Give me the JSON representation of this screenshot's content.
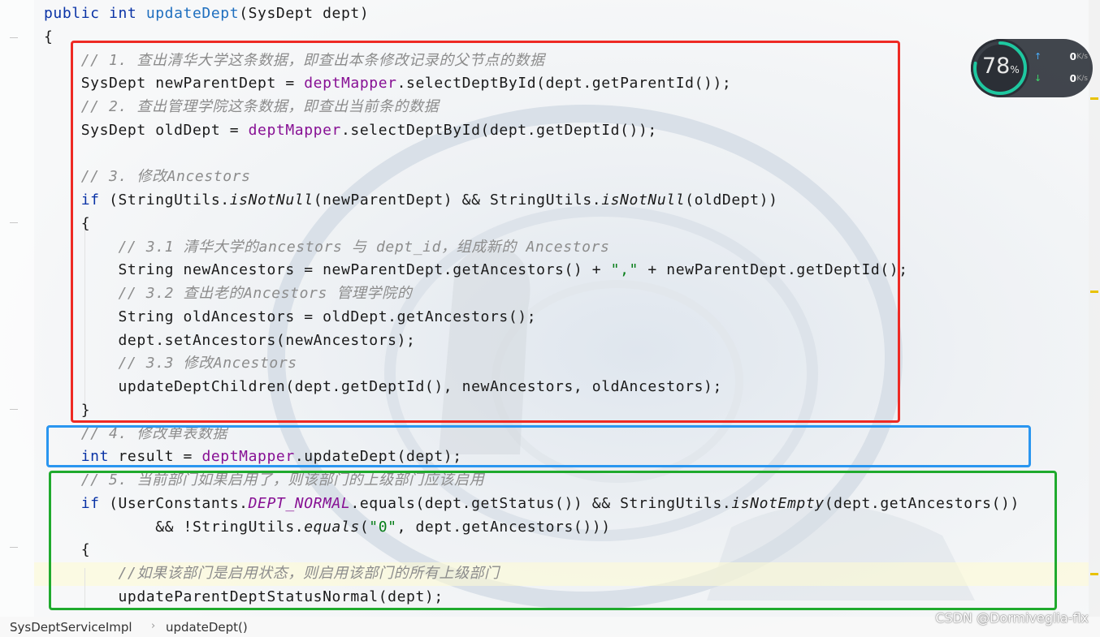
{
  "code_lines": [
    {
      "n": 0,
      "parts": [
        [
          "kw",
          "public "
        ],
        [
          "kw",
          "int "
        ],
        [
          "fn",
          "updateDept"
        ],
        [
          "",
          "(SysDept dept)"
        ]
      ]
    },
    {
      "n": 1,
      "parts": [
        [
          "",
          "{"
        ]
      ]
    },
    {
      "n": 2,
      "parts": [
        [
          "",
          "    "
        ],
        [
          "cm",
          "// 1. 查出清华大学这条数据，即查出本条修改记录的父节点的数据"
        ]
      ]
    },
    {
      "n": 3,
      "parts": [
        [
          "",
          "    SysDept newParentDept = "
        ],
        [
          "field",
          "deptMapper"
        ],
        [
          "",
          ".selectDeptById(dept.getParentId());"
        ]
      ]
    },
    {
      "n": 4,
      "parts": [
        [
          "",
          "    "
        ],
        [
          "cm",
          "// 2. 查出管理学院这条数据，即查出当前条的数据"
        ]
      ]
    },
    {
      "n": 5,
      "parts": [
        [
          "",
          "    SysDept oldDept = "
        ],
        [
          "field",
          "deptMapper"
        ],
        [
          "",
          ".selectDeptById(dept.getDeptId());"
        ]
      ]
    },
    {
      "n": 6,
      "parts": [
        [
          "",
          ""
        ]
      ]
    },
    {
      "n": 7,
      "parts": [
        [
          "",
          "    "
        ],
        [
          "cm",
          "// 3. 修改Ancestors"
        ]
      ]
    },
    {
      "n": 8,
      "parts": [
        [
          "",
          "    "
        ],
        [
          "kw",
          "if "
        ],
        [
          "",
          "(StringUtils."
        ],
        [
          "it",
          "isNotNull"
        ],
        [
          "",
          "(newParentDept) && StringUtils."
        ],
        [
          "it",
          "isNotNull"
        ],
        [
          "",
          "(oldDept))"
        ]
      ]
    },
    {
      "n": 9,
      "parts": [
        [
          "",
          "    {"
        ]
      ]
    },
    {
      "n": 10,
      "parts": [
        [
          "",
          "        "
        ],
        [
          "cm",
          "// 3.1 清华大学的ancestors 与 dept_id，组成新的 Ancestors"
        ]
      ]
    },
    {
      "n": 11,
      "parts": [
        [
          "",
          "        String newAncestors = newParentDept.getAncestors() + "
        ],
        [
          "str",
          "\",\""
        ],
        [
          "",
          " + newParentDept.getDeptId();"
        ]
      ]
    },
    {
      "n": 12,
      "parts": [
        [
          "",
          "        "
        ],
        [
          "cm",
          "// 3.2 查出老的Ancestors 管理学院的"
        ]
      ]
    },
    {
      "n": 13,
      "parts": [
        [
          "",
          "        String oldAncestors = oldDept.getAncestors();"
        ]
      ]
    },
    {
      "n": 14,
      "parts": [
        [
          "",
          "        dept.setAncestors(newAncestors);"
        ]
      ]
    },
    {
      "n": 15,
      "parts": [
        [
          "",
          "        "
        ],
        [
          "cm",
          "// 3.3 修改Ancestors"
        ]
      ]
    },
    {
      "n": 16,
      "parts": [
        [
          "",
          "        updateDeptChildren(dept.getDeptId(), newAncestors, oldAncestors);"
        ]
      ]
    },
    {
      "n": 17,
      "parts": [
        [
          "",
          "    }"
        ]
      ]
    },
    {
      "n": 18,
      "parts": [
        [
          "",
          "    "
        ],
        [
          "cm",
          "// 4. 修改单表数据"
        ]
      ]
    },
    {
      "n": 19,
      "parts": [
        [
          "",
          "    "
        ],
        [
          "kw",
          "int "
        ],
        [
          "",
          "result = "
        ],
        [
          "field",
          "deptMapper"
        ],
        [
          "",
          ".updateDept(dept);"
        ]
      ]
    },
    {
      "n": 20,
      "parts": [
        [
          "",
          "    "
        ],
        [
          "cm",
          "// 5. 当前部门如果启用了，则该部门的上级部门应该启用"
        ]
      ]
    },
    {
      "n": 21,
      "parts": [
        [
          "",
          "    "
        ],
        [
          "kw",
          "if "
        ],
        [
          "",
          "(UserConstants."
        ],
        [
          "cst",
          "DEPT_NORMAL"
        ],
        [
          "",
          ".equals(dept.getStatus()) && StringUtils."
        ],
        [
          "it",
          "isNotEmpty"
        ],
        [
          "",
          "(dept.getAncestors())"
        ]
      ]
    },
    {
      "n": 22,
      "parts": [
        [
          "",
          "            && !StringUtils."
        ],
        [
          "it",
          "equals"
        ],
        [
          "",
          "("
        ],
        [
          "str",
          "\"0\""
        ],
        [
          "",
          ", dept.getAncestors()))"
        ]
      ]
    },
    {
      "n": 23,
      "parts": [
        [
          "",
          "    {"
        ]
      ]
    },
    {
      "n": 24,
      "parts": [
        [
          "",
          "        "
        ],
        [
          "cm",
          "//如果该部门是启用状态，则启用该部门的所有上级部门"
        ]
      ]
    },
    {
      "n": 25,
      "parts": [
        [
          "",
          "        updateParentDeptStatusNormal(dept);"
        ]
      ]
    }
  ],
  "breadcrumb": {
    "class_name": "SysDeptServiceImpl",
    "separator": "›",
    "method_name": "updateDept()"
  },
  "net_widget": {
    "cpu_percent": "78",
    "cpu_unit": "%",
    "upload_value": "0",
    "upload_unit": "K/s",
    "download_value": "0",
    "download_unit": "K/s",
    "upload_arrow": "↑",
    "download_arrow": "↓"
  },
  "watermark": "CSDN @Dormiveglia-flx",
  "colors": {
    "keyword": "#0a33a6",
    "field": "#871094",
    "comment": "#8c8c8c",
    "string": "#067d17",
    "box_red": "#ee2a24",
    "box_blue": "#2a96f0",
    "box_green": "#1faa2d"
  }
}
